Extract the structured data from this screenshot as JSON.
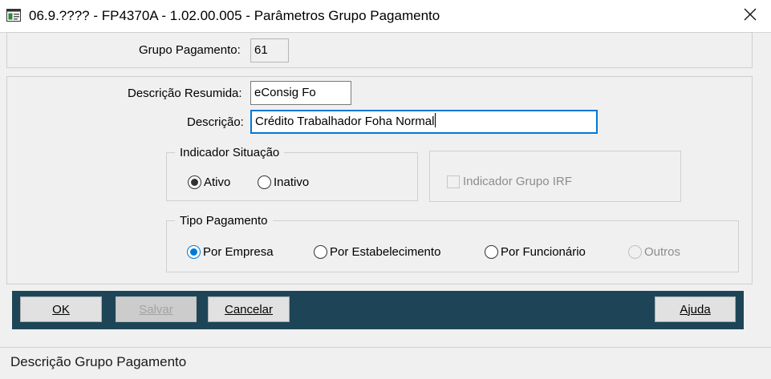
{
  "window": {
    "title": "06.9.???? - FP4370A - 1.02.00.005 - Parâmetros Grupo Pagamento",
    "icon": "app-window-icon",
    "close_icon": "close-icon"
  },
  "form": {
    "grupo_pagamento": {
      "label": "Grupo Pagamento:",
      "value": "61"
    },
    "descricao_resumida": {
      "label": "Descrição Resumida:",
      "value": "eConsig Fo"
    },
    "descricao": {
      "label": "Descrição:",
      "value": "Crédito Trabalhador  Foha Normal"
    },
    "indicador_situacao": {
      "legend": "Indicador Situação",
      "options": [
        {
          "label": "Ativo",
          "selected": true
        },
        {
          "label": "Inativo",
          "selected": false
        }
      ]
    },
    "indicador_grupo_irf": {
      "label": "Indicador Grupo IRF",
      "checked": false,
      "enabled": false
    },
    "tipo_pagamento": {
      "legend": "Tipo Pagamento",
      "options": [
        {
          "label": "Por Empresa",
          "selected": true,
          "enabled": true
        },
        {
          "label": "Por Estabelecimento",
          "selected": false,
          "enabled": true
        },
        {
          "label": "Por Funcionário",
          "selected": false,
          "enabled": true
        },
        {
          "label": "Outros",
          "selected": false,
          "enabled": false
        }
      ]
    }
  },
  "buttons": {
    "ok": "OK",
    "salvar": "Salvar",
    "cancelar": "Cancelar",
    "ajuda": "Ajuda"
  },
  "colors": {
    "button_bar": "#1e4557",
    "focus_border": "#0078d7"
  },
  "status": {
    "text": "Descrição Grupo Pagamento"
  }
}
